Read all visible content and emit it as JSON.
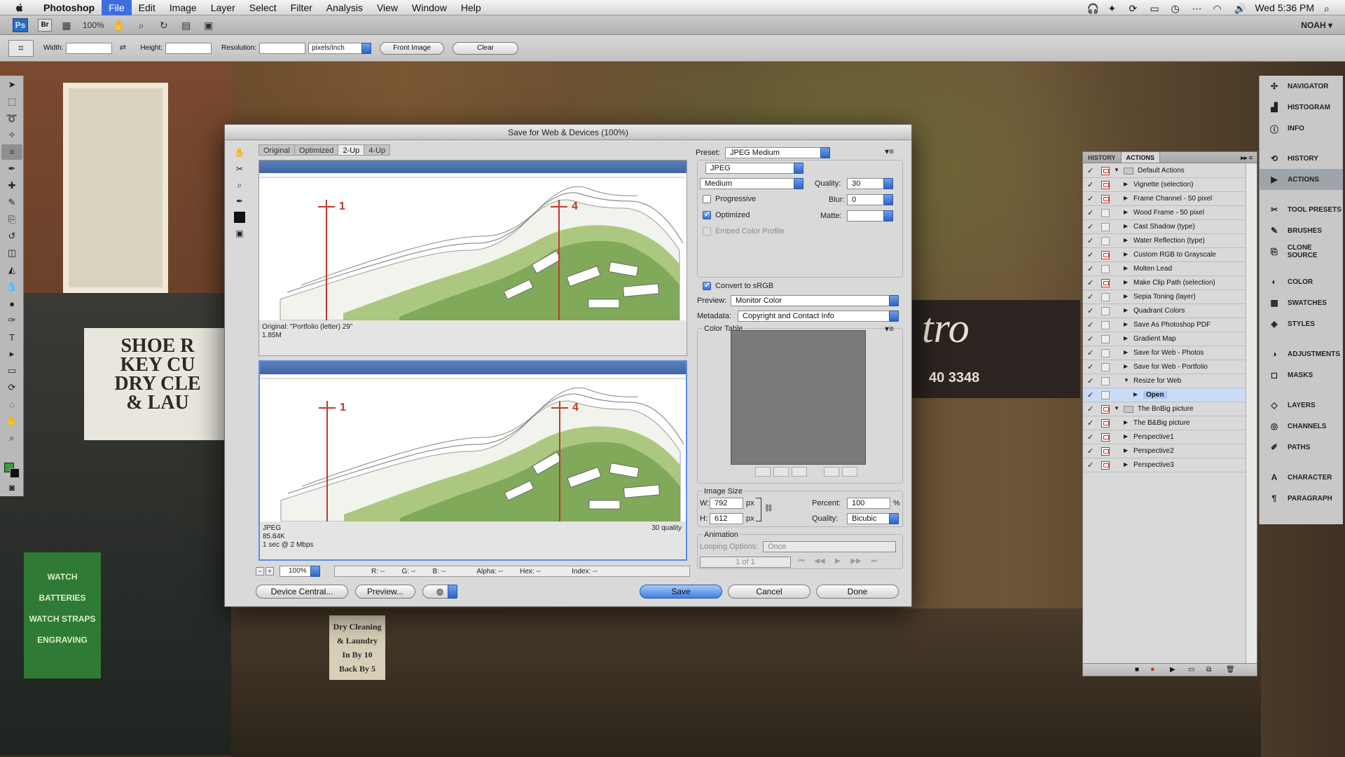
{
  "menubar": {
    "app": "Photoshop",
    "items": [
      "File",
      "Edit",
      "Image",
      "Layer",
      "Select",
      "Filter",
      "Analysis",
      "View",
      "Window",
      "Help"
    ],
    "clock": "Wed 5:36 PM"
  },
  "appbar": {
    "ps": "Ps",
    "br": "Br",
    "zoom": "100%",
    "workspace": "NOAH ▾"
  },
  "options": {
    "width_label": "Width:",
    "height_label": "Height:",
    "resolution_label": "Resolution:",
    "units": "pixels/inch",
    "front_image": "Front Image",
    "clear": "Clear"
  },
  "dialog": {
    "title": "Save for Web & Devices (100%)",
    "tabs": [
      "Original",
      "Optimized",
      "2-Up",
      "4-Up"
    ],
    "original_info": [
      "Original: \"Portfolio (letter) 29\"",
      "1.85M"
    ],
    "optimized_info": [
      "JPEG",
      "85.84K",
      "1 sec @ 2 Mbps"
    ],
    "optimized_quality": "30 quality",
    "markers": [
      "1",
      "4"
    ],
    "status": {
      "zoom": "100%",
      "r": "R: --",
      "g": "G: --",
      "b": "B: --",
      "alpha": "Alpha: --",
      "hex": "Hex: --",
      "index": "Index: --"
    },
    "buttons": {
      "device_central": "Device Central...",
      "preview": "Preview...",
      "save": "Save",
      "cancel": "Cancel",
      "done": "Done"
    },
    "settings": {
      "preset_label": "Preset:",
      "preset": "JPEG Medium",
      "format": "JPEG",
      "quality_level": "Medium",
      "quality_label": "Quality:",
      "quality": "30",
      "blur_label": "Blur:",
      "blur": "0",
      "matte_label": "Matte:",
      "progressive": "Progressive",
      "optimized": "Optimized",
      "embed_profile": "Embed Color Profile",
      "convert_srgb": "Convert to sRGB",
      "preview_label": "Preview:",
      "preview": "Monitor Color",
      "metadata_label": "Metadata:",
      "metadata": "Copyright and Contact Info",
      "color_table": "Color Table",
      "image_size": "Image Size",
      "w_label": "W:",
      "w": "792",
      "h_label": "H:",
      "h": "612",
      "px": "px",
      "percent_label": "Percent:",
      "percent": "100",
      "percent_sign": "%",
      "resample_label": "Quality:",
      "resample": "Bicubic",
      "animation": "Animation",
      "looping_label": "Looping Options:",
      "looping": "Once",
      "frame": "1 of 1"
    }
  },
  "dock": {
    "items": [
      {
        "icon": "navigator-icon",
        "glyph": "✣",
        "label": "NAVIGATOR"
      },
      {
        "icon": "histogram-icon",
        "glyph": "▟",
        "label": "HISTOGRAM"
      },
      {
        "icon": "info-icon",
        "glyph": "ⓘ",
        "label": "INFO"
      },
      {
        "icon": "history-icon",
        "glyph": "⟲",
        "label": "HISTORY"
      },
      {
        "icon": "actions-icon",
        "glyph": "▶",
        "label": "ACTIONS"
      },
      {
        "icon": "tool-presets-icon",
        "glyph": "✂",
        "label": "TOOL PRESETS"
      },
      {
        "icon": "brushes-icon",
        "glyph": "✎",
        "label": "BRUSHES"
      },
      {
        "icon": "clone-source-icon",
        "glyph": "⎘",
        "label": "CLONE SOURCE"
      },
      {
        "icon": "color-icon",
        "glyph": "◐",
        "label": "COLOR"
      },
      {
        "icon": "swatches-icon",
        "glyph": "▦",
        "label": "SWATCHES"
      },
      {
        "icon": "styles-icon",
        "glyph": "◈",
        "label": "STYLES"
      },
      {
        "icon": "adjustments-icon",
        "glyph": "◑",
        "label": "ADJUSTMENTS"
      },
      {
        "icon": "masks-icon",
        "glyph": "◻",
        "label": "MASKS"
      },
      {
        "icon": "layers-icon",
        "glyph": "◇",
        "label": "LAYERS"
      },
      {
        "icon": "channels-icon",
        "glyph": "◎",
        "label": "CHANNELS"
      },
      {
        "icon": "paths-icon",
        "glyph": "✐",
        "label": "PATHS"
      },
      {
        "icon": "character-icon",
        "glyph": "A",
        "label": "CHARACTER"
      },
      {
        "icon": "paragraph-icon",
        "glyph": "¶",
        "label": "PARAGRAPH"
      }
    ]
  },
  "actions_panel": {
    "tabs": [
      "HISTORY",
      "ACTIONS"
    ],
    "rows": [
      {
        "label": "Default Actions",
        "level": 0,
        "open": true,
        "folder": true,
        "dlg": "red"
      },
      {
        "label": "Vignette (selection)",
        "level": 1,
        "dlg": "red"
      },
      {
        "label": "Frame Channel - 50 pixel",
        "level": 1,
        "dlg": "red"
      },
      {
        "label": "Wood Frame - 50 pixel",
        "level": 1,
        "dlg": ""
      },
      {
        "label": "Cast Shadow (type)",
        "level": 1,
        "dlg": ""
      },
      {
        "label": "Water Reflection (type)",
        "level": 1,
        "dlg": ""
      },
      {
        "label": "Custom RGB to Grayscale",
        "level": 1,
        "dlg": "red"
      },
      {
        "label": "Molten Lead",
        "level": 1,
        "dlg": ""
      },
      {
        "label": "Make Clip Path (selection)",
        "level": 1,
        "dlg": "red"
      },
      {
        "label": "Sepia Toning (layer)",
        "level": 1,
        "dlg": ""
      },
      {
        "label": "Quadrant Colors",
        "level": 1,
        "dlg": ""
      },
      {
        "label": "Save As Photoshop PDF",
        "level": 1,
        "dlg": "gray"
      },
      {
        "label": "Gradient Map",
        "level": 1,
        "dlg": ""
      },
      {
        "label": "Save for Web - Photos",
        "level": 1,
        "dlg": ""
      },
      {
        "label": "Save for Web - Portfolio",
        "level": 1,
        "dlg": ""
      },
      {
        "label": "Resize for Web",
        "level": 1,
        "open": true,
        "dlg": ""
      },
      {
        "label": "Open",
        "level": 2,
        "highlight": true,
        "dlg": ""
      },
      {
        "label": "The BnBig picture",
        "level": 0,
        "open": true,
        "folder": true,
        "dlg": "red"
      },
      {
        "label": "The B&Big picture",
        "level": 1,
        "dlg": "red"
      },
      {
        "label": "Perspective1",
        "level": 1,
        "dlg": "red"
      },
      {
        "label": "Perspective2",
        "level": 1,
        "dlg": "red"
      },
      {
        "label": "Perspective3",
        "level": 1,
        "dlg": "red"
      }
    ]
  },
  "background": {
    "signs": [
      "SHOE R",
      "KEY CU",
      "DRY CLE",
      "& LAU"
    ],
    "green_sign": [
      "WATCH BATTERIES",
      "WATCH STRAPS",
      "ENGRAVING"
    ],
    "dry_cleaning": [
      "Dry Cleaning",
      "& Laundry",
      "In By 10",
      "Back By 5"
    ],
    "tro": "tro",
    "phone": "40 3348"
  }
}
